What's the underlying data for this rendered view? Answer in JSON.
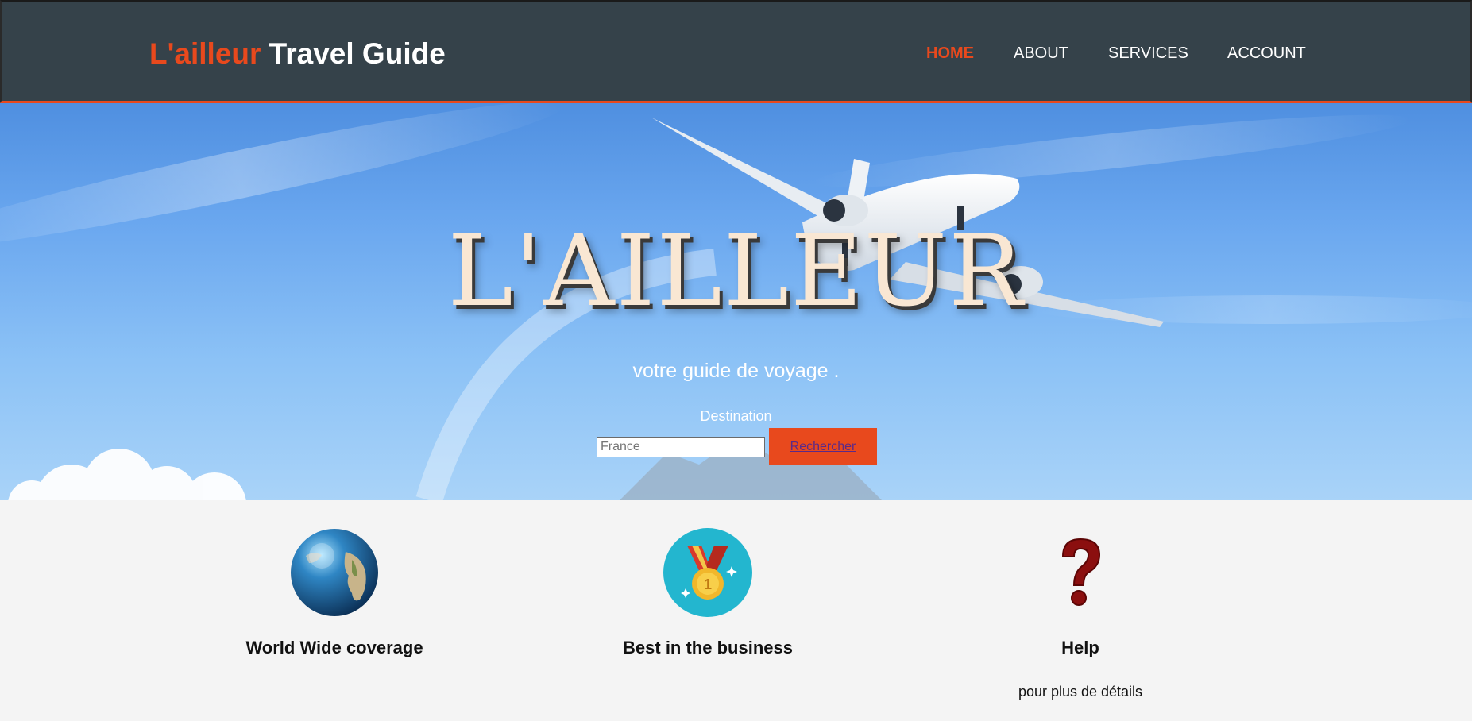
{
  "header": {
    "logo_accent": "L'ailleur",
    "logo_rest": " Travel Guide",
    "nav": [
      {
        "label": "HOME",
        "active": true
      },
      {
        "label": "ABOUT",
        "active": false
      },
      {
        "label": "SERVICES",
        "active": false
      },
      {
        "label": "ACCOUNT",
        "active": false
      }
    ]
  },
  "hero": {
    "title": "L'AILLEUR",
    "subtitle": "votre guide de voyage .",
    "destination_label": "Destination",
    "search_placeholder": "France",
    "search_button": "Rechercher"
  },
  "features": [
    {
      "icon": "globe-icon",
      "title": "World Wide coverage",
      "text": ""
    },
    {
      "icon": "medal-icon",
      "title": "Best in the business",
      "text": ""
    },
    {
      "icon": "question-mark-icon",
      "title": "Help",
      "text": "pour plus de détails"
    }
  ],
  "colors": {
    "header_bg": "#35424a",
    "accent": "#e8491d",
    "page_bg": "#f4f4f4"
  }
}
